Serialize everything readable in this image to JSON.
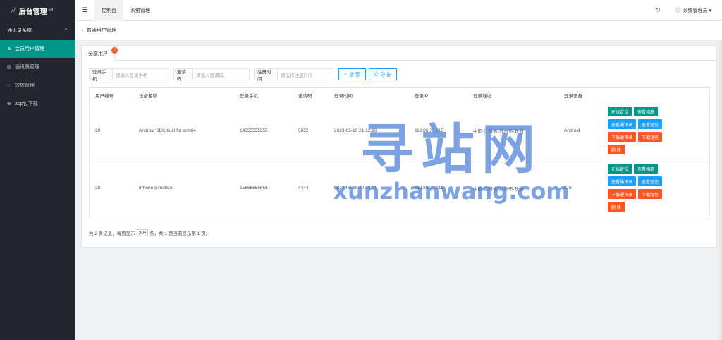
{
  "app": {
    "logo_mark": "//",
    "title": "后台管理",
    "version": "v3"
  },
  "sidebar": {
    "group": "通讯录系统",
    "items": [
      {
        "label": "会员用户管理",
        "icon": "user-icon",
        "glyph": "♙",
        "active": true
      },
      {
        "label": "通讯录管理",
        "icon": "contacts-icon",
        "glyph": "▤",
        "active": false
      },
      {
        "label": "短信管理",
        "icon": "message-icon",
        "glyph": "◌",
        "active": false
      },
      {
        "label": "app包下载",
        "icon": "download-icon",
        "glyph": "⊕",
        "active": false
      }
    ]
  },
  "header": {
    "menu_icon": "☰",
    "tabs": [
      {
        "label": "控制台",
        "active": true
      },
      {
        "label": "系统管理",
        "active": false
      }
    ],
    "refresh_icon": "↻",
    "user_name": "系统管理员",
    "user_caret": "▾"
  },
  "breadcrumb": {
    "icon": "»",
    "text": "普通用户管理"
  },
  "card": {
    "tab_label": "全部用户",
    "tab_badge": "2"
  },
  "filters": {
    "phone": {
      "label": "登录手机",
      "placeholder": "请输入登录手机"
    },
    "invite": {
      "label": "邀请码",
      "placeholder": "请输入邀请码"
    },
    "reg_time": {
      "label": "注册时间",
      "placeholder": "请选择注册时间"
    },
    "search_button": "搜 索",
    "search_icon": "⌕",
    "export_button": "导 出",
    "export_icon": "⎙"
  },
  "table": {
    "columns": [
      "用户编号",
      "设备名称",
      "登录手机",
      "邀请码",
      "登录时间",
      "登录IP",
      "登录地址",
      "登录设备"
    ],
    "rows": [
      {
        "id": "29",
        "device": "Android SDK built for arm64",
        "phone": "14555555555",
        "invite": "5652",
        "login_time": "2023-05-16 21:12:26",
        "ip": "112.86.73.215",
        "address": "中国-江苏省-苏州市-联通",
        "device_os": "Android"
      },
      {
        "id": "28",
        "device": "iPhone Simulator",
        "phone": "15666666666",
        "invite": "4444",
        "login_time": "2023-05-16 20:49:31",
        "ip": "112.86.73.211",
        "address": "中国-江苏省-苏州市-联通",
        "device_os": "iOS"
      }
    ],
    "actions": {
      "locate": "在线定位",
      "album": "查看相册",
      "contacts": "查看通讯录",
      "sms": "查看短信",
      "download_contacts": "下载通讯录",
      "download_sms": "下载短信",
      "delete": "删 除"
    }
  },
  "pager": {
    "prefix": "共 2 条记录，每页显示",
    "page_size": "20",
    "page_size_caret": "▾",
    "suffix": "条，共 1 页当前显示第 1 页。"
  },
  "watermark": {
    "big": "寻站网",
    "small": "xunzhanwang.com"
  },
  "colors": {
    "sidebar_bg": "#23262e",
    "accent": "#009688",
    "blue": "#1e9fff",
    "red": "#ff5722"
  }
}
